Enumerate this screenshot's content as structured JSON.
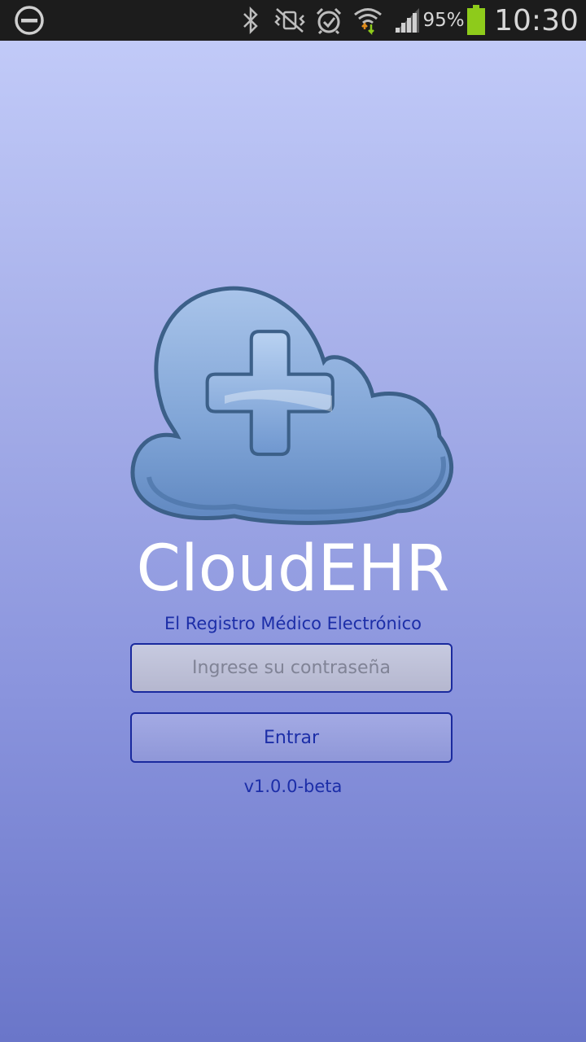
{
  "status_bar": {
    "battery_percent": "95%",
    "time": "10:30",
    "icons": [
      "do-not-disturb-icon",
      "bluetooth-icon",
      "vibrate-icon",
      "alarm-icon",
      "wifi-icon",
      "signal-icon",
      "battery-icon"
    ],
    "battery_color": "#8ecb1b"
  },
  "login": {
    "app_name": "CloudEHR",
    "tagline": "El Registro Médico Electrónico",
    "password_placeholder": "Ingrese su contraseña",
    "password_value": "",
    "submit_label": "Entrar",
    "version": "v1.0.0-beta"
  },
  "colors": {
    "background_top": "#c1caf8",
    "background_bottom": "#6a76c9",
    "accent_text": "#1c2ea8",
    "border": "#1a2a9e",
    "cloud": "#7aa2d4"
  }
}
